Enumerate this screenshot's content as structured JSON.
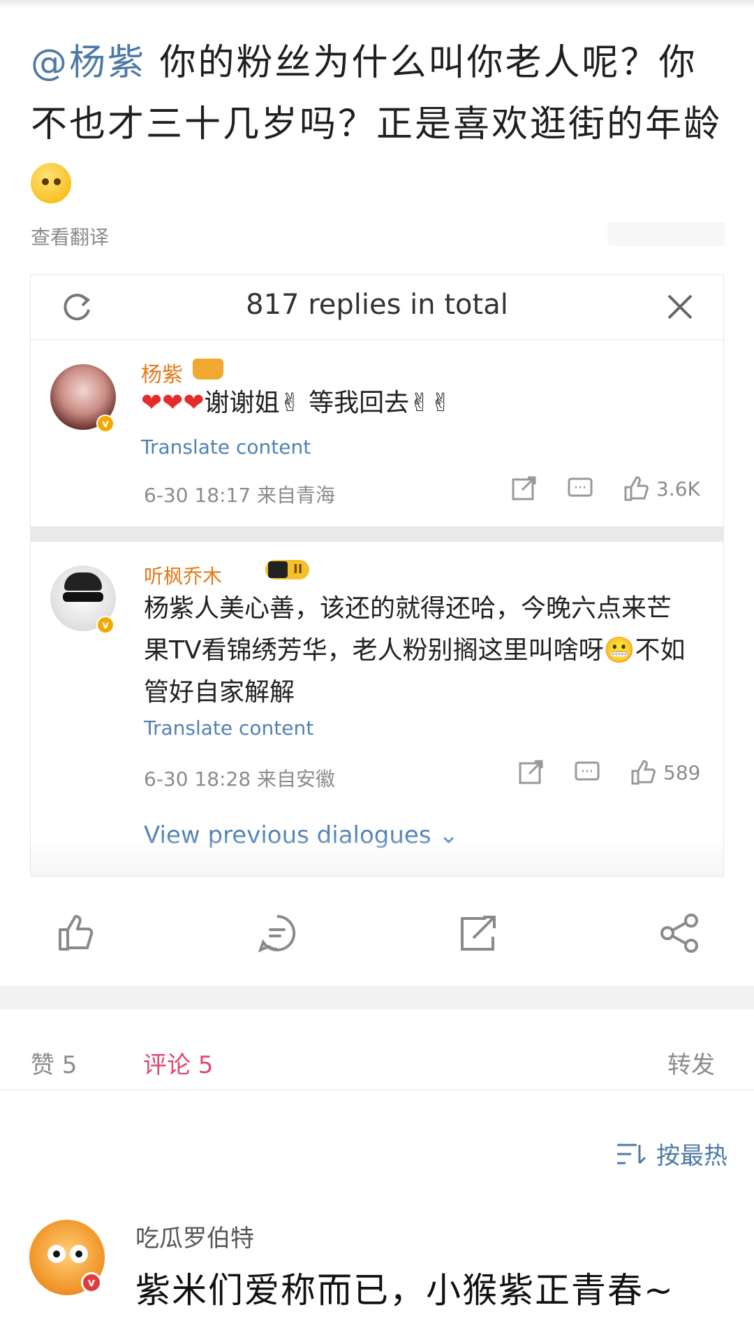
{
  "post": {
    "mention": "@杨紫",
    "text": " 你的粉丝为什么叫你老人呢？你不也才三十几岁吗？正是喜欢逛街的年龄",
    "emoji": "thinking-emoji",
    "translate_label": "查看翻译"
  },
  "embed": {
    "title": "817 replies in total",
    "reply1": {
      "username": "杨紫",
      "hearts": "❤❤❤",
      "text": "谢谢姐✌ 等我回去✌✌",
      "translate": "Translate content",
      "meta": "6-30 18:17  来自青海",
      "likes": "3.6K"
    },
    "reply2": {
      "username": "听枫乔木",
      "level": "II",
      "line1": "杨紫人美心善，该还的就得还哈，今晚六点来芒",
      "line2": "果TV看锦绣芳华，老人粉别搁这里叫啥呀😬不如",
      "line3": "管好自家解解",
      "translate": "Translate content",
      "meta": "6-30 18:28  来自安徽",
      "likes": "589"
    },
    "view_previous": "View previous dialogues ⌄"
  },
  "tabs": {
    "like": "赞 5",
    "comment": "评论 5",
    "repost": "转发"
  },
  "sort": {
    "label": "按最热"
  },
  "comment": {
    "username": "吃瓜罗伯特",
    "text": "紫米们爱称而已，小猴紫正青春~"
  },
  "colors": {
    "mention": "#4c7aa6",
    "accent_comment": "#e0476e",
    "link": "#4f82b3",
    "username_orange": "#e27a1a"
  }
}
